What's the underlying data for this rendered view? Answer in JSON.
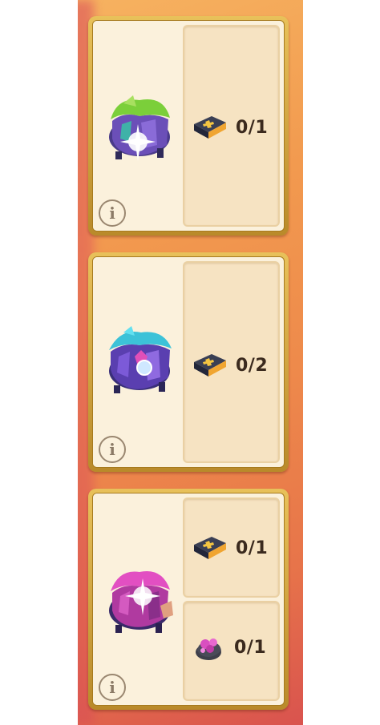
{
  "cards": [
    {
      "info_icon": "i",
      "hero_icon": "green-purple-crystal-house-icon",
      "requirements": [
        {
          "icon": "gold-cross-spellbook-icon",
          "count": "0/1"
        }
      ]
    },
    {
      "info_icon": "i",
      "hero_icon": "blue-purple-crystal-house-icon",
      "requirements": [
        {
          "icon": "gold-cross-spellbook-icon",
          "count": "0/2"
        }
      ]
    },
    {
      "info_icon": "i",
      "hero_icon": "pink-crystal-house-icon",
      "requirements": [
        {
          "icon": "gold-cross-spellbook-icon",
          "count": "0/1"
        },
        {
          "icon": "pink-crystal-pouch-icon",
          "count": "0/1"
        }
      ]
    }
  ],
  "colors": {
    "card_frame": "#d4a53e",
    "card_bg": "#fbf1dc",
    "slot_bg": "#f6e3c2",
    "text": "#3b2a1e",
    "strip_top": "#f6b260",
    "strip_bottom": "#d9534e"
  }
}
